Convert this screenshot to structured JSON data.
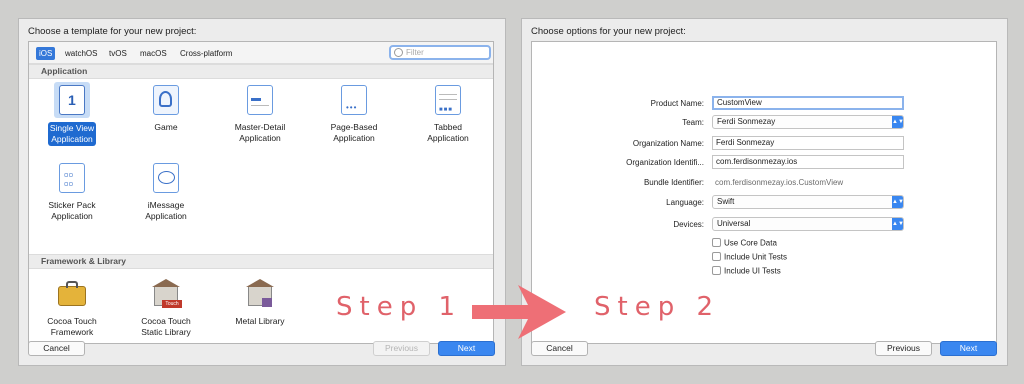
{
  "left": {
    "title": "Choose a template for your new project:",
    "tabs": [
      "iOS",
      "watchOS",
      "tvOS",
      "macOS",
      "Cross-platform"
    ],
    "filter_placeholder": "Filter",
    "section_application": "Application",
    "section_framework": "Framework & Library",
    "templates": [
      {
        "label": "Single View\nApplication",
        "icon": "single-view-icon",
        "selected": true
      },
      {
        "label": "Game",
        "icon": "game-icon"
      },
      {
        "label": "Master-Detail\nApplication",
        "icon": "master-detail-icon"
      },
      {
        "label": "Page-Based\nApplication",
        "icon": "page-based-icon"
      },
      {
        "label": "Tabbed\nApplication",
        "icon": "tabbed-icon"
      },
      {
        "label": "Sticker Pack\nApplication",
        "icon": "sticker-pack-icon"
      },
      {
        "label": "iMessage\nApplication",
        "icon": "imessage-icon"
      }
    ],
    "frameworks": [
      {
        "label": "Cocoa Touch\nFramework",
        "icon": "toolbox-icon"
      },
      {
        "label": "Cocoa Touch\nStatic Library",
        "icon": "building-touch-icon"
      },
      {
        "label": "Metal Library",
        "icon": "building-metal-icon"
      }
    ],
    "cancel": "Cancel",
    "previous": "Previous",
    "next": "Next"
  },
  "right": {
    "title": "Choose options for your new project:",
    "product_name_label": "Product Name:",
    "product_name": "CustomView",
    "team_label": "Team:",
    "team": "Ferdi Sonmezay",
    "org_name_label": "Organization Name:",
    "org_name": "Ferdi Sonmezay",
    "org_id_label": "Organization Identifi...",
    "org_id": "com.ferdisonmezay.ios",
    "bundle_label": "Bundle Identifier:",
    "bundle": "com.ferdisonmezay.ios.CustomView",
    "language_label": "Language:",
    "language": "Swift",
    "devices_label": "Devices:",
    "devices": "Universal",
    "checks": [
      "Use Core Data",
      "Include Unit Tests",
      "Include UI Tests"
    ],
    "cancel": "Cancel",
    "previous": "Previous",
    "next": "Next"
  },
  "annotations": {
    "step1": "Step 1",
    "step2": "Step 2",
    "arrow_color": "#ee6f76"
  }
}
